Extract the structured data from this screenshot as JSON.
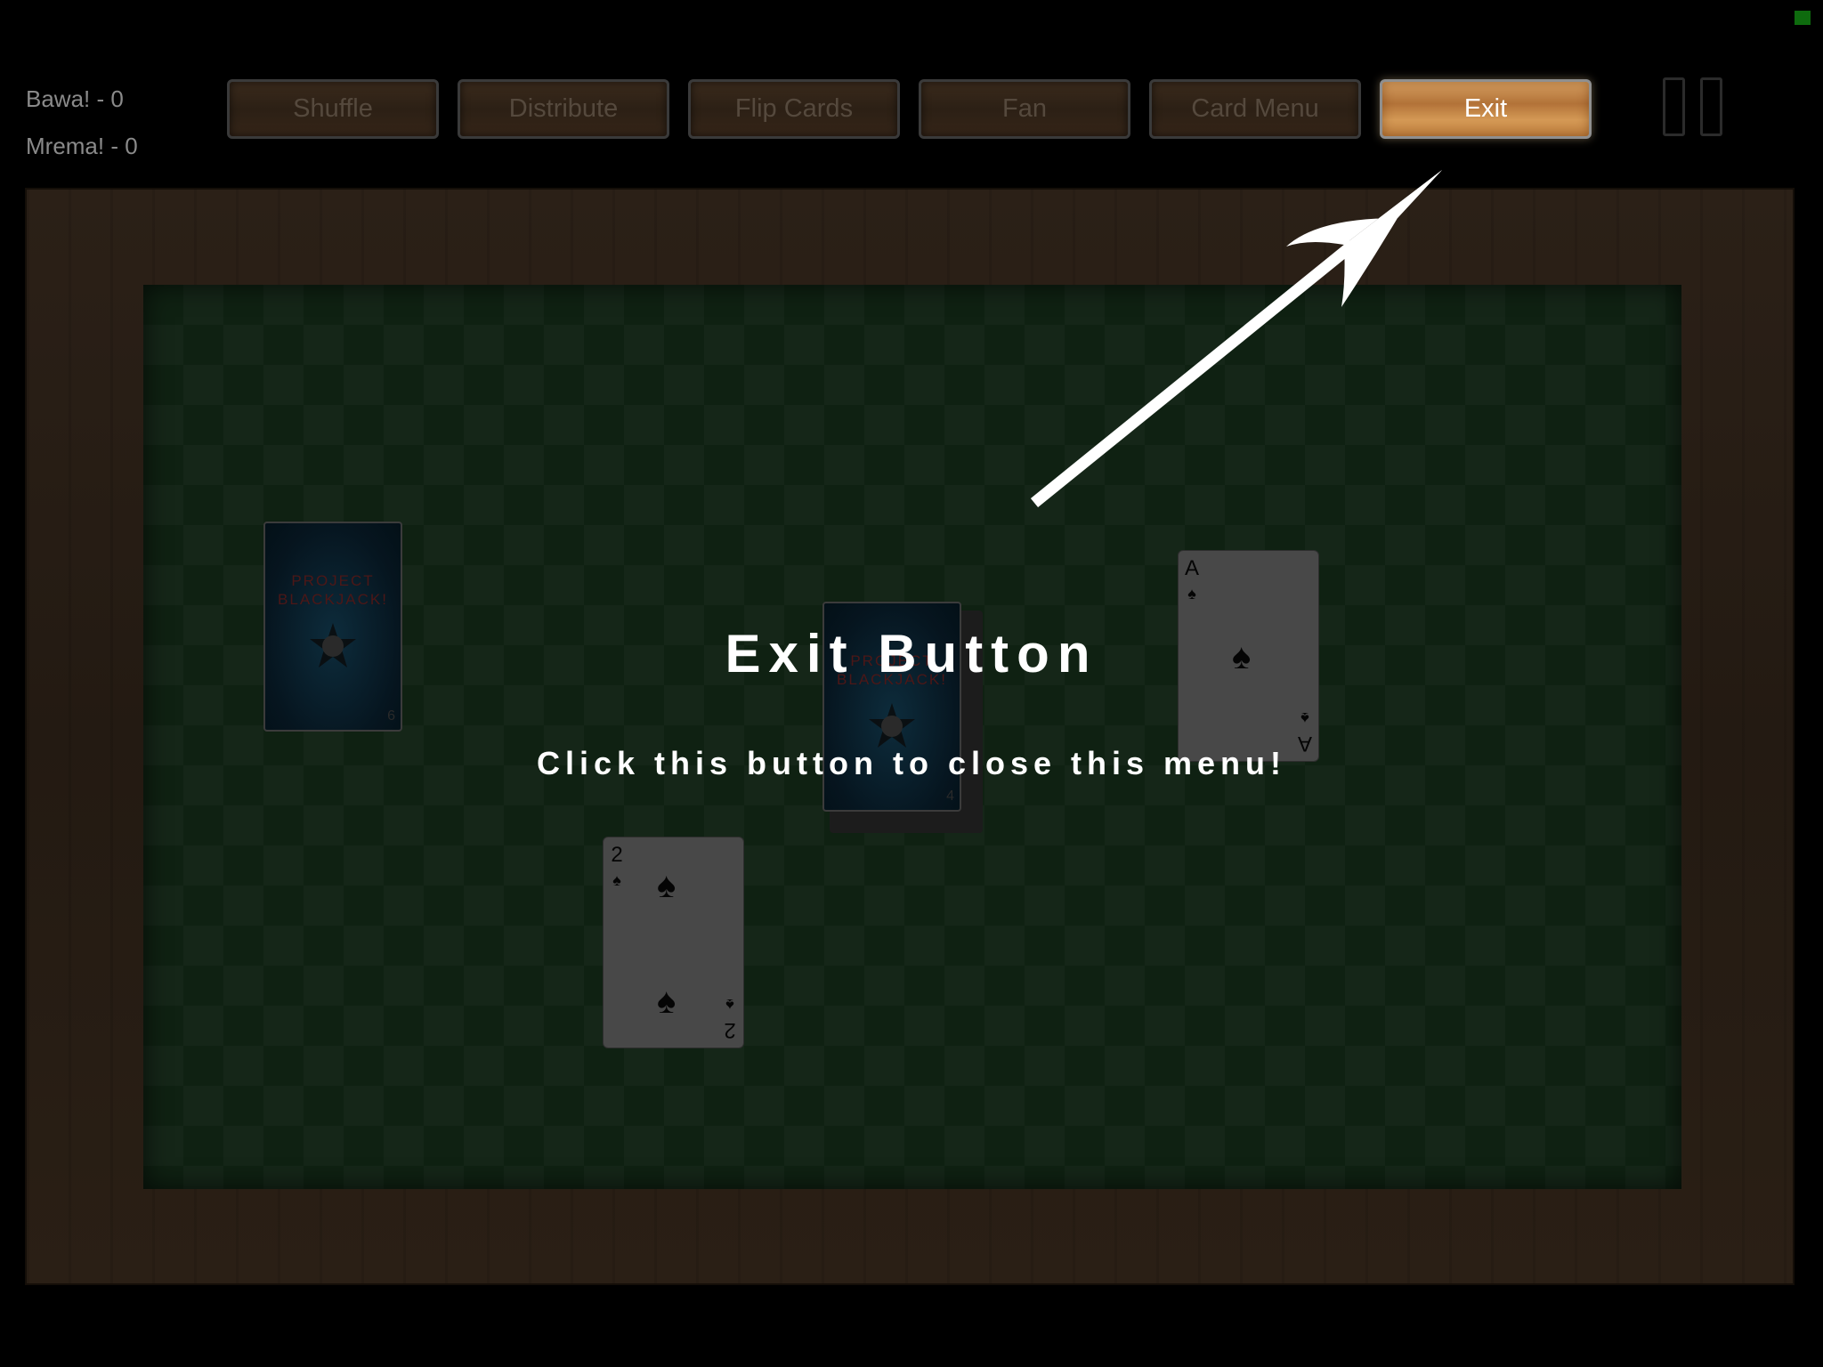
{
  "scores": {
    "player1": "Bawa! - 0",
    "player2": "Mrema! - 0"
  },
  "toolbar": {
    "shuffle": "Shuffle",
    "distribute": "Distribute",
    "flip_cards": "Flip Cards",
    "fan": "Fan",
    "card_menu": "Card Menu",
    "exit": "Exit"
  },
  "tutorial": {
    "title": "Exit Button",
    "text": "Click this button to close this menu!"
  },
  "cards": {
    "back_brand_line1": "PROJECT",
    "back_brand_line2": "BLACKJACK!",
    "ace": {
      "rank": "A",
      "suit": "♠"
    },
    "two": {
      "rank": "2",
      "suit": "♠"
    }
  },
  "colors": {
    "felt": "#0f2112",
    "wood": "#2b2017",
    "exit_button": "#c98a4c"
  }
}
